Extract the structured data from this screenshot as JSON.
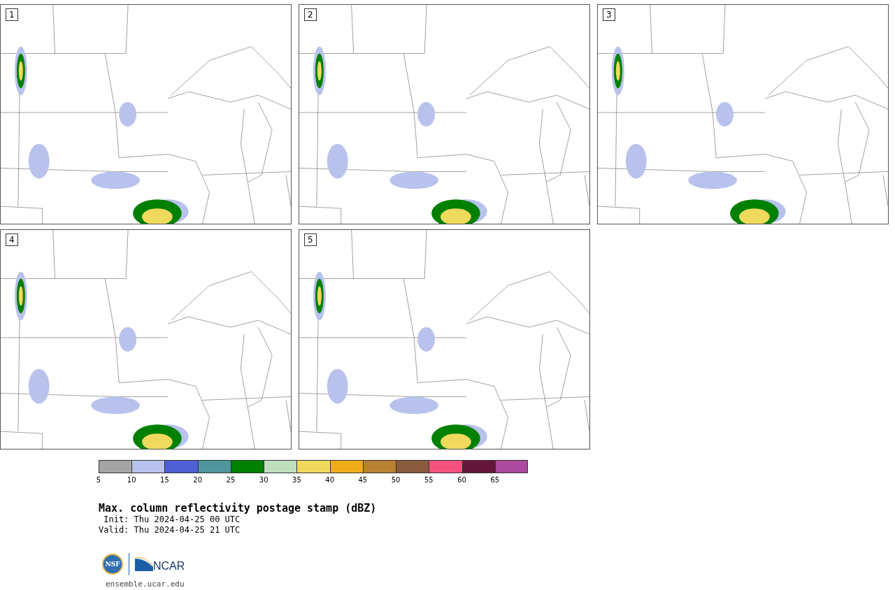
{
  "panels": [
    {
      "label": "1"
    },
    {
      "label": "2"
    },
    {
      "label": "3"
    },
    {
      "label": "4"
    },
    {
      "label": "5"
    }
  ],
  "colorbar": {
    "segments": [
      {
        "color": "#a5a5a5",
        "tick": "5"
      },
      {
        "color": "#b8c2ec",
        "tick": "10"
      },
      {
        "color": "#505fd6",
        "tick": "15"
      },
      {
        "color": "#4f979c",
        "tick": "20"
      },
      {
        "color": "#008000",
        "tick": "25"
      },
      {
        "color": "#bfdfbf",
        "tick": "30"
      },
      {
        "color": "#efda5d",
        "tick": "35"
      },
      {
        "color": "#efad18",
        "tick": "40"
      },
      {
        "color": "#b8812f",
        "tick": "45"
      },
      {
        "color": "#8a5a3e",
        "tick": "50"
      },
      {
        "color": "#f4527d",
        "tick": "55"
      },
      {
        "color": "#65173a",
        "tick": "60"
      },
      {
        "color": "#ab4a9f",
        "tick": "65"
      }
    ]
  },
  "title": "Max. column reflectivity postage stamp (dBZ)",
  "init": " Init: Thu 2024-04-25 00 UTC",
  "valid": "Valid: Thu 2024-04-25 21 UTC",
  "logo": {
    "seal": "NSF",
    "wordmark": "NCAR"
  },
  "site": "ensemble.ucar.edu"
}
